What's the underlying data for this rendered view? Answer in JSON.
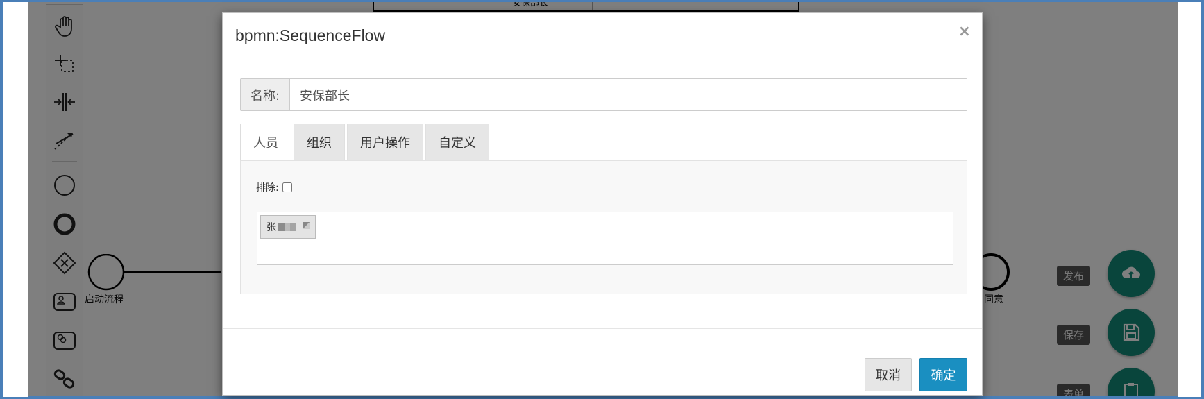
{
  "diagram": {
    "top_label": "安保部长",
    "start_label": "启动流程",
    "end_label": "同意"
  },
  "fab": {
    "publish_label": "发布",
    "save_label": "保存",
    "form_label": "表单"
  },
  "modal": {
    "title": "bpmn:SequenceFlow",
    "close": "×",
    "name_label": "名称:",
    "name_value": "安保部长",
    "tabs": [
      {
        "label": "人员"
      },
      {
        "label": "组织"
      },
      {
        "label": "用户操作"
      },
      {
        "label": "自定义"
      }
    ],
    "exclude_label": "排除:",
    "selected_user": "张",
    "cancel_label": "取消",
    "ok_label": "确定"
  },
  "colors": {
    "accent": "#1a8fc1",
    "fab": "#138a78",
    "frame": "#4a7fb8"
  }
}
